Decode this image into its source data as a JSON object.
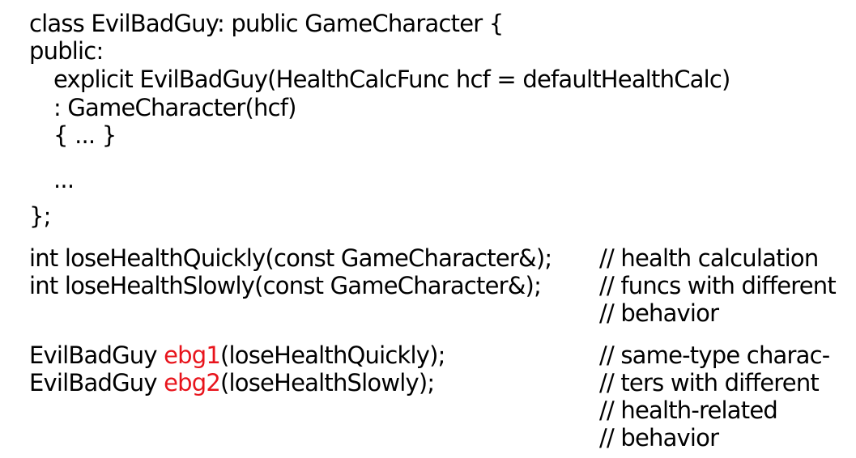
{
  "code": {
    "class_decl": {
      "l1": "class EvilBadGuy: public GameCharacter {",
      "l2": "public:",
      "l3": "explicit EvilBadGuy(HealthCalcFunc hcf = defaultHealthCalc)",
      "l4": ": GameCharacter(hcf)",
      "l5": "{ ... }",
      "l6": "...",
      "l7": "};"
    },
    "funcs": {
      "quick": "int loseHealthQuickly(const GameCharacter&);",
      "slow": "int loseHealthSlowly(const GameCharacter&);",
      "comment": [
        "// health calculation",
        "// funcs with different",
        "// behavior"
      ]
    },
    "objects": {
      "obj1": {
        "type": "EvilBadGuy ",
        "name": "ebg1",
        "args": "(loseHealthQuickly);"
      },
      "obj2": {
        "type": "EvilBadGuy ",
        "name": "ebg2",
        "args": "(loseHealthSlowly);"
      },
      "comment": [
        "// same-type charac-",
        "// ters with different",
        "// health-related",
        "// behavior"
      ]
    },
    "highlight_color": "#e8141c"
  }
}
